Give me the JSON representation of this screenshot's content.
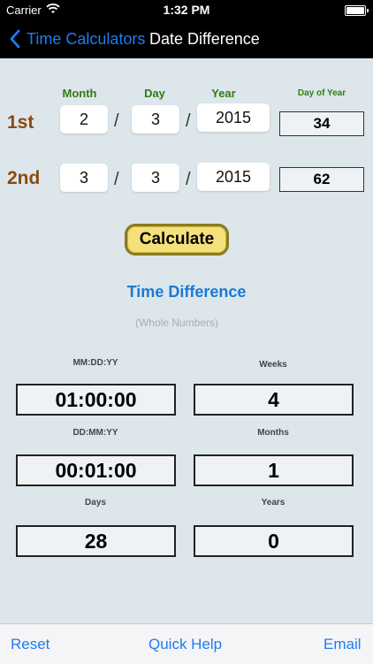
{
  "status_bar": {
    "carrier": "Carrier",
    "time": "1:32 PM"
  },
  "nav": {
    "back_label": "Time Calculators",
    "title": "Date Difference"
  },
  "inputs": {
    "headers": {
      "month": "Month",
      "day": "Day",
      "year": "Year",
      "day_of_year": "Day of Year"
    },
    "slash": "/",
    "rows": [
      {
        "label": "1st",
        "month": "2",
        "day": "3",
        "year": "2015",
        "day_of_year": "34"
      },
      {
        "label": "2nd",
        "month": "3",
        "day": "3",
        "year": "2015",
        "day_of_year": "62"
      }
    ]
  },
  "calculate_label": "Calculate",
  "result": {
    "title": "Time Difference",
    "subtitle": "(Whole Numbers)",
    "mmddyy_label": "MM:DD:YY",
    "mmddyy_value": "01:00:00",
    "weeks_label": "Weeks",
    "weeks_value": "4",
    "ddmmyy_label": "DD:MM:YY",
    "ddmmyy_value": "00:01:00",
    "months_label": "Months",
    "months_value": "1",
    "days_label": "Days",
    "days_value": "28",
    "years_label": "Years",
    "years_value": "0"
  },
  "toolbar": {
    "reset": "Reset",
    "quick_help": "Quick Help",
    "email": "Email"
  }
}
